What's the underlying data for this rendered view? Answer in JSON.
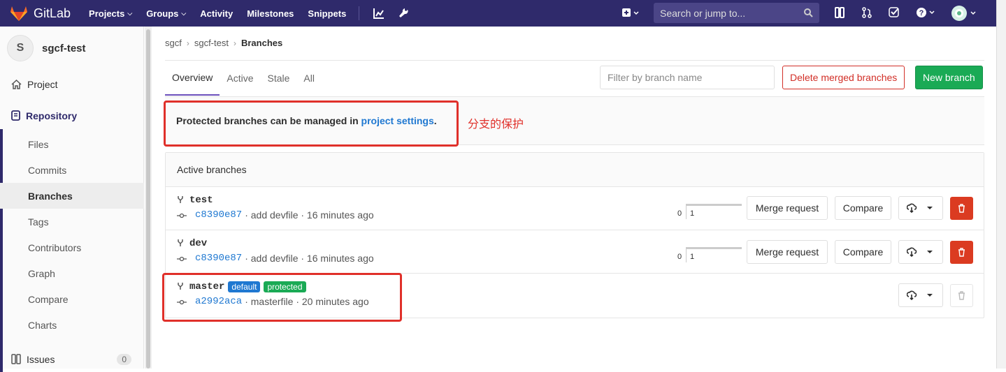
{
  "topnav": {
    "brand": "GitLab",
    "links": [
      "Projects",
      "Groups",
      "Activity",
      "Milestones",
      "Snippets"
    ],
    "search_placeholder": "Search or jump to..."
  },
  "sidebar": {
    "avatar_letter": "S",
    "project_name": "sgcf-test",
    "project_label": "Project",
    "repository_label": "Repository",
    "sub_items": [
      "Files",
      "Commits",
      "Branches",
      "Tags",
      "Contributors",
      "Graph",
      "Compare",
      "Charts"
    ],
    "issues_label": "Issues",
    "issues_count": "0"
  },
  "breadcrumb": [
    "sgcf",
    "sgcf-test",
    "Branches"
  ],
  "tabs": [
    "Overview",
    "Active",
    "Stale",
    "All"
  ],
  "filter_placeholder": "Filter by branch name",
  "buttons": {
    "delete_merged": "Delete merged branches",
    "new_branch": "New branch",
    "merge_request": "Merge request",
    "compare": "Compare"
  },
  "info": {
    "text_before": "Protected branches can be managed in ",
    "link_text": "project settings",
    "text_after": "."
  },
  "annotation": "分支的保护",
  "panel_title": "Active branches",
  "branches": [
    {
      "name": "test",
      "sha": "c8390e87",
      "message": "· add devfile · 16 minutes ago",
      "behind": "0",
      "ahead": "1"
    },
    {
      "name": "dev",
      "sha": "c8390e87",
      "message": "· add devfile · 16 minutes ago",
      "behind": "0",
      "ahead": "1"
    },
    {
      "name": "master",
      "sha": "a2992aca",
      "message": "· masterfile · 20 minutes ago",
      "labels": [
        "default",
        "protected"
      ]
    }
  ],
  "colors": {
    "nav": "#2f2a6b",
    "link": "#1f78d1",
    "danger": "#d22f27",
    "success": "#1aaa55",
    "default_label": "#1f78d1",
    "protected_label": "#1aaa55",
    "annotation": "#e0302a"
  }
}
